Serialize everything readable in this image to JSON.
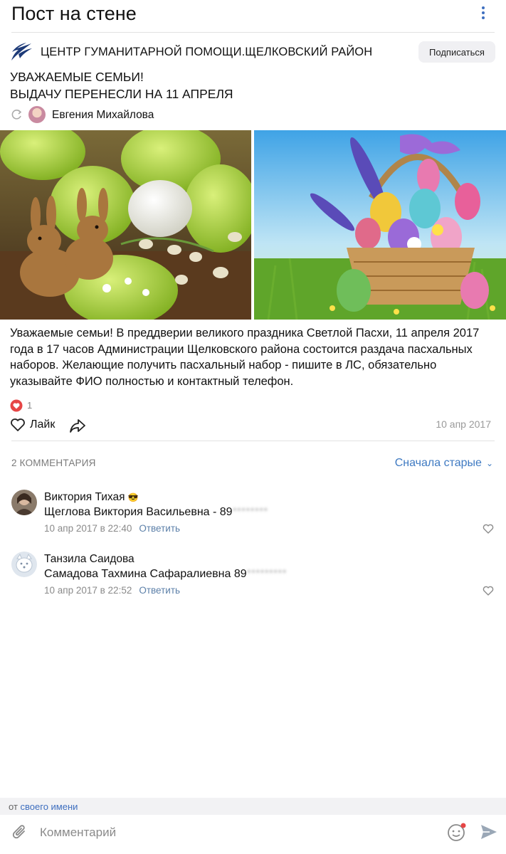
{
  "header": {
    "title": "Пост на стене",
    "more_icon": "more-vertical-icon"
  },
  "group": {
    "name": "ЦЕНТР ГУМАНИТАРНОЙ ПОМОЩИ.ЩЕЛКОВСКИЙ РАЙОН",
    "subscribe_label": "Подписаться",
    "logo_icon": "swallow-logo-icon"
  },
  "post": {
    "headline_line1": "УВАЖАЕМЫЕ СЕМЬИ!",
    "headline_line2": "ВЫДАЧУ ПЕРЕНЕСЛИ НА 11 АПРЕЛЯ",
    "repost_author": "Евгения Михайлова",
    "body_part1": "Уважаемые семьи! В преддверии великого праздника Светлой Пасхи, 11 апреля 2017 года в 17 часов Администрации Щелковского района состоится раздача пасхальных наборов",
    "body_part2": ". Желающие получить пасхальный набор - пишите в ЛС",
    "body_part3": ", обязательно указывайте ФИО полностью и контактный телефон.",
    "reaction_count": "1",
    "like_label": "Лайк",
    "date": "10 апр 2017"
  },
  "comments_section": {
    "count_label": "2 КОММЕНТАРИЯ",
    "sort_label": "Сначала старые",
    "items": [
      {
        "author": "Виктория Тихая",
        "author_emoji": "😎",
        "text": "Щеглова Виктория Васильевна - 89",
        "text_hidden": "********",
        "date": "10 апр 2017 в 22:40",
        "reply_label": "Ответить"
      },
      {
        "author": "Танзила Саидова",
        "text": "Самадова Тахмина Сафаралиевна",
        "text_tail": " 89",
        "text_hidden": "*********",
        "date": "10 апр 2017 в 22:52",
        "reply_label": "Ответить"
      }
    ]
  },
  "footer": {
    "from_prefix": "от",
    "from_link": "своего имени",
    "input_placeholder": "Комментарий"
  },
  "colors": {
    "accent": "#3f6fbf",
    "highlight": "#ec788c",
    "heart": "#e64646"
  }
}
